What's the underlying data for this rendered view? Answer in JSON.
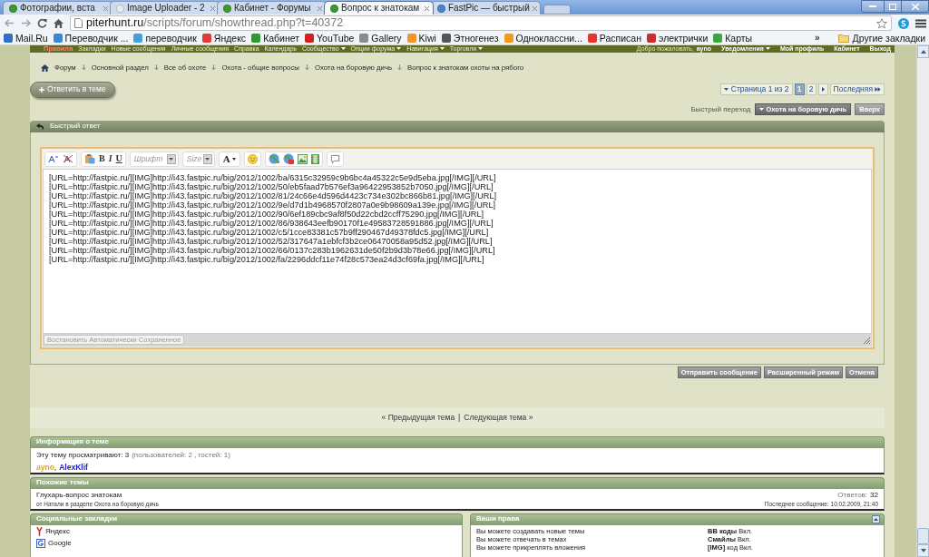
{
  "browser": {
    "tabs": [
      {
        "title": "Фотографии, вста",
        "color": "#3a9a2a",
        "selected": false
      },
      {
        "title": "Image Uploader - 2",
        "color": "#e8ecf2",
        "selected": false
      },
      {
        "title": "Кабинет - Форумы",
        "color": "#3a9a2a",
        "selected": false
      },
      {
        "title": "Вопрос к знатокам",
        "color": "#3a9a2a",
        "selected": true
      },
      {
        "title": "FastPic — быстрый",
        "color": "#4a82cc",
        "selected": false
      }
    ],
    "address": {
      "host": "piterhunt.ru",
      "path": "/scripts/forum/showthread.php?t=40372"
    },
    "bookmarks": [
      {
        "label": "Mail.Ru",
        "color": "#2f6fc8"
      },
      {
        "label": "Переводчик ...",
        "color": "#3b86d6"
      },
      {
        "label": "переводчик",
        "color": "#44a0d8"
      },
      {
        "label": "Яндекс",
        "color": "#e03a3a"
      },
      {
        "label": "Кабинет",
        "color": "#2e9a2e"
      },
      {
        "label": "YouTube",
        "color": "#d21f1f"
      },
      {
        "label": "Gallery",
        "color": "#8a8a8a"
      },
      {
        "label": "Kiwi",
        "color": "#f0962a"
      },
      {
        "label": "Этногенез",
        "color": "#555555"
      },
      {
        "label": "Одноклассни...",
        "color": "#f39a1e"
      },
      {
        "label": "Расписан",
        "color": "#e8342a"
      },
      {
        "label": "электрички",
        "color": "#c83030"
      },
      {
        "label": "Карты",
        "color": "#3aa83a"
      }
    ],
    "more": "»",
    "other_bookmarks": "Другие закладки"
  },
  "navbar": {
    "items": [
      {
        "label": "Правила",
        "kind": "alert"
      },
      {
        "label": "Закладки",
        "kind": "link"
      },
      {
        "label": "Новые сообщения",
        "kind": "link"
      },
      {
        "label": "Личные сообщения",
        "kind": "link"
      },
      {
        "label": "Справка",
        "kind": "link"
      },
      {
        "label": "Календарь",
        "kind": "link"
      },
      {
        "label": "Сообщество",
        "kind": "menu"
      },
      {
        "label": "Опции форума",
        "kind": "menu"
      },
      {
        "label": "Навигация",
        "kind": "menu"
      },
      {
        "label": "Торговля",
        "kind": "menu"
      }
    ],
    "welcome": "Добро пожаловать,",
    "username": "ayno",
    "user_links": [
      {
        "label": "Уведомления",
        "kind": "menu"
      },
      {
        "label": "Мой профиль",
        "kind": "link"
      },
      {
        "label": "Кабинет",
        "kind": "link"
      },
      {
        "label": "Выход",
        "kind": "link"
      }
    ]
  },
  "breadcrumb": [
    "Форум",
    "Основной раздел",
    "Все об охоте",
    "Охота - общие вопросы",
    "Охота на боровую дичь",
    "Вопрос к знатокам охоты на рябого"
  ],
  "reply_button": "Ответить в теме",
  "pagination": {
    "label": "Страница 1 из 2",
    "pages": [
      {
        "label": "1",
        "selected": true
      },
      {
        "label": "2",
        "selected": false
      }
    ],
    "last": "Последняя"
  },
  "quick_nav": {
    "label": "Быстрый переход",
    "forum": "Охота на боровую дичь",
    "top": "Вверх"
  },
  "quick_reply": {
    "title": "Быстрый ответ",
    "toolbar": {
      "bold": "B",
      "italic": "I",
      "underline": "U",
      "font": "Шрифт",
      "size": "Size",
      "font_color_button": "A"
    },
    "lines": [
      "[URL=http://fastpic.ru/][IMG]http://i43.fastpic.ru/big/2012/1002/ba/6315c32959c9b6bc4a45322c5e9d5eba.jpg[/IMG][/URL]",
      "[URL=http://fastpic.ru/][IMG]http://i43.fastpic.ru/big/2012/1002/50/eb5faad7b576ef3a96422953852b7050.jpg[/IMG][/URL]",
      "[URL=http://fastpic.ru/][IMG]http://i43.fastpic.ru/big/2012/1002/81/24c66e4d596d4423c734e302bc866b81.jpg[/IMG][/URL]",
      "[URL=http://fastpic.ru/][IMG]http://i43.fastpic.ru/big/2012/1002/9e/d7d1b4968570f2807a0e9b98609a139e.jpg[/IMG][/URL]",
      "[URL=http://fastpic.ru/][IMG]http://i43.fastpic.ru/big/2012/1002/90/6ef189cbc9af8f50d22cbd2ccff75290.jpg[/IMG][/URL]",
      "[URL=http://fastpic.ru/][IMG]http://i43.fastpic.ru/big/2012/1002/86/938643eefb90170f1e49583728591886.jpg[/IMG][/URL]",
      "[URL=http://fastpic.ru/][IMG]http://i43.fastpic.ru/big/2012/1002/c5/1cce83381c57b9ff290467d49378fdc5.jpg[/IMG][/URL]",
      "[URL=http://fastpic.ru/][IMG]http://i43.fastpic.ru/big/2012/1002/52/317647a1ebfcf3b2ce06470058a95d52.jpg[/IMG][/URL]",
      "[URL=http://fastpic.ru/][IMG]http://i43.fastpic.ru/big/2012/1002/66/0137c283b1962631de50f2b9d3b78e66.jpg[/IMG][/URL]",
      "[URL=http://fastpic.ru/][IMG]http://i43.fastpic.ru/big/2012/1002/fa/2296ddcf11e74f28c573ea24d3cf69fa.jpg[/IMG][/URL]"
    ],
    "restore": "Востановить Автоматически Сохраненное",
    "buttons": [
      "Отправить сообщение",
      "Расширенный режим",
      "Отмена"
    ]
  },
  "thread_nav": {
    "prev": "« Предыдущая тема",
    "separator": "|",
    "next": "Следующая тема »"
  },
  "thread_info": {
    "title": "Информация о теме",
    "viewers": "Эту тему просматривают: 3",
    "viewers_detail": "(пользователей: 2 , гостей: 1)",
    "users": [
      {
        "name": "ayno",
        "color": "#e8a317"
      },
      {
        "name": "AlexKlif",
        "color": "#1b1bd0"
      }
    ],
    "user_separator": ","
  },
  "similar_threads": {
    "title": "Похожие темы",
    "rows": [
      {
        "title": "Глухарь-вопрос знатокам",
        "meta": "от Натали в разделе Охота на боровую дичь",
        "replies_label": "Ответов:",
        "replies": "32",
        "last_post": "Последнее сообщение: 10.02.2009, 21:40"
      }
    ]
  },
  "social_bookmarks": {
    "title": "Социальные закладки",
    "items": [
      {
        "label": "Яндекс",
        "kind": "ribbon"
      },
      {
        "label": "Google",
        "kind": "tile"
      }
    ]
  },
  "your_rights": {
    "title": "Ваши права",
    "rows": [
      {
        "permission": "Вы можете создавать новые темы",
        "setting": "**BB коды** Вкл."
      },
      {
        "permission": "Вы можете отвечать в темах",
        "setting": "**Смайлы** Вкл."
      },
      {
        "permission": "Вы можете прикреплять вложения",
        "setting": "**[IMG]** код Вкл."
      }
    ]
  }
}
